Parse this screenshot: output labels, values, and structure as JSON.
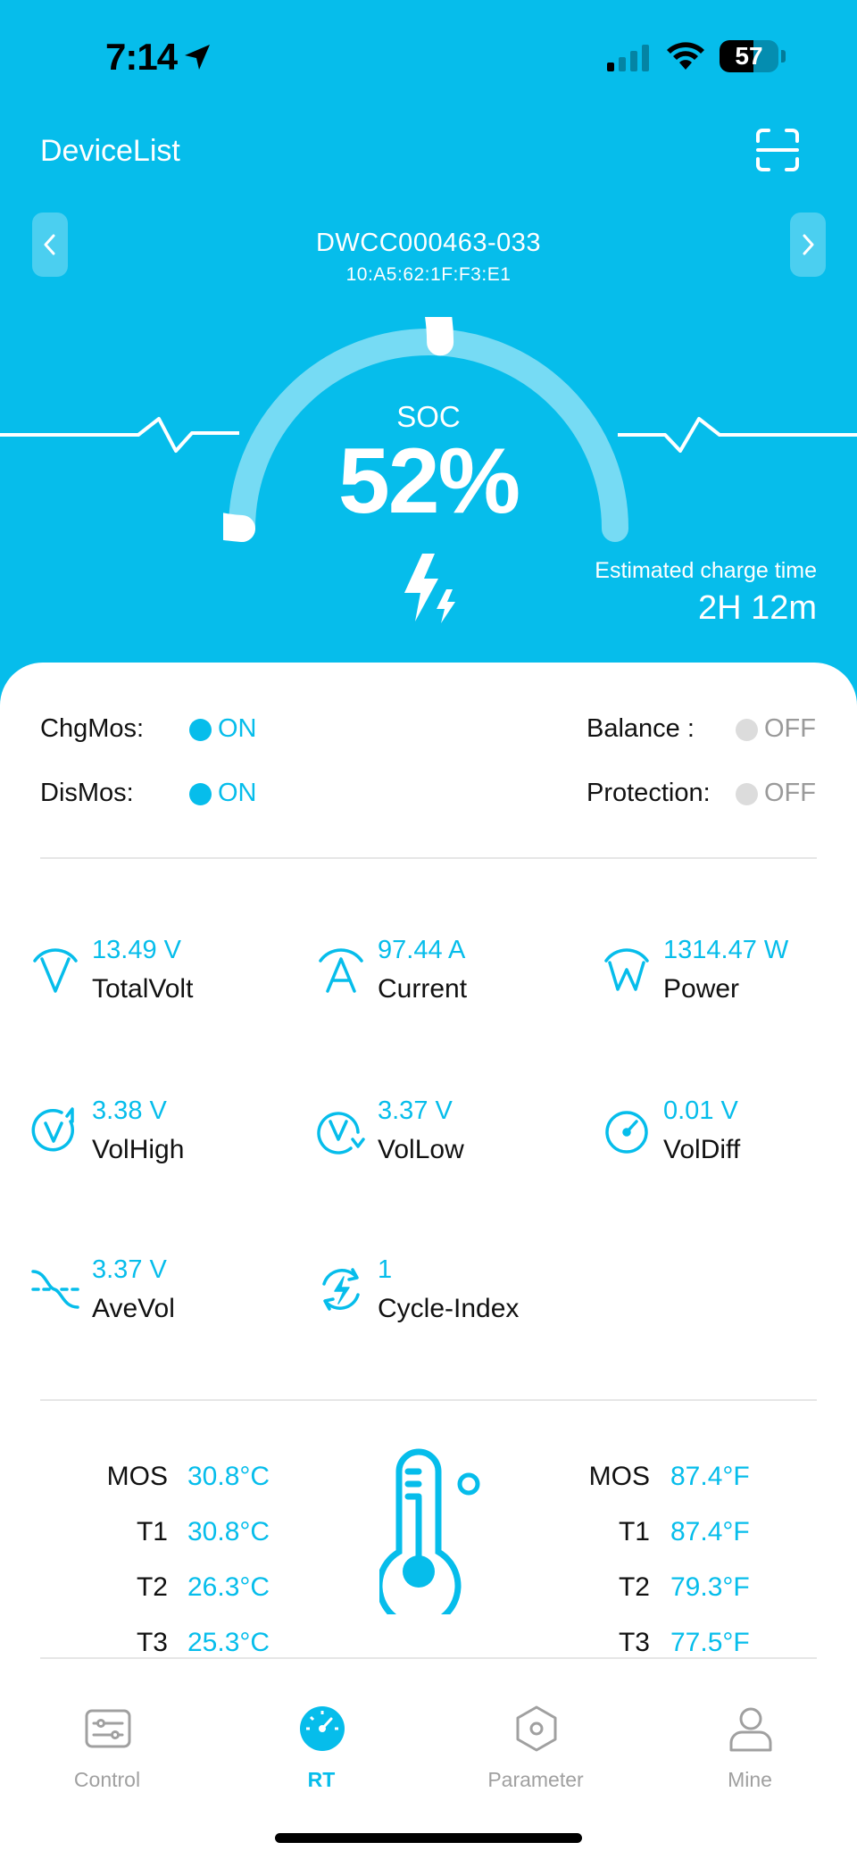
{
  "status_bar": {
    "time": "7:14",
    "battery": "57",
    "battery_level": 0.57
  },
  "header": {
    "title": "DeviceList"
  },
  "device": {
    "name": "DWCC000463-033",
    "mac": "10:A5:62:1F:F3:E1"
  },
  "gauge": {
    "label": "SOC",
    "value": "52%",
    "level": 0.52
  },
  "estimate": {
    "label": "Estimated charge time",
    "value": "2H 12m"
  },
  "switches": {
    "chgmos": {
      "label": "ChgMos:",
      "state": "ON"
    },
    "dismos": {
      "label": "DisMos:",
      "state": "ON"
    },
    "balance": {
      "label": "Balance :",
      "state": "OFF"
    },
    "protection": {
      "label": "Protection:",
      "state": "OFF"
    }
  },
  "metrics": {
    "totalvolt": {
      "value": "13.49 V",
      "label": "TotalVolt"
    },
    "current": {
      "value": "97.44 A",
      "label": "Current"
    },
    "power": {
      "value": "1314.47 W",
      "label": "Power"
    },
    "volhigh": {
      "value": "3.38 V",
      "label": "VolHigh"
    },
    "vollow": {
      "value": "3.37 V",
      "label": "VolLow"
    },
    "voldiff": {
      "value": "0.01 V",
      "label": "VolDiff"
    },
    "avevol": {
      "value": "3.37 V",
      "label": "AveVol"
    },
    "cycle": {
      "value": "1",
      "label": "Cycle-Index"
    }
  },
  "temperatures": {
    "celsius": [
      {
        "name": "MOS",
        "value": "30.8°C"
      },
      {
        "name": "T1",
        "value": "30.8°C"
      },
      {
        "name": "T2",
        "value": "26.3°C"
      },
      {
        "name": "T3",
        "value": "25.3°C"
      }
    ],
    "fahrenheit": [
      {
        "name": "MOS",
        "value": "87.4°F"
      },
      {
        "name": "T1",
        "value": "87.4°F"
      },
      {
        "name": "T2",
        "value": "79.3°F"
      },
      {
        "name": "T3",
        "value": "77.5°F"
      }
    ]
  },
  "tabs": [
    {
      "label": "Control",
      "icon": "sliders-icon"
    },
    {
      "label": "RT",
      "icon": "gauge-icon"
    },
    {
      "label": "Parameter",
      "icon": "hexagon-nut-icon"
    },
    {
      "label": "Mine",
      "icon": "user-icon"
    }
  ],
  "colors": {
    "accent": "#06bdeb",
    "off": "#dcdcdc"
  }
}
